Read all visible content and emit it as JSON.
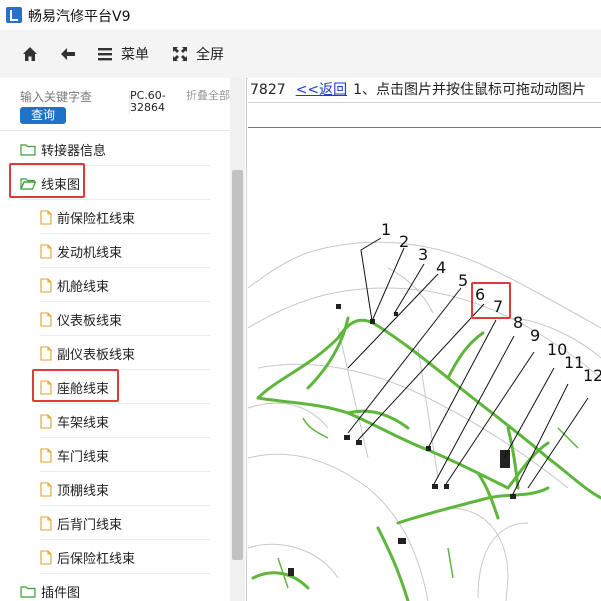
{
  "window": {
    "title": "畅易汽修平台V9"
  },
  "toolbar": {
    "home_icon": "home-icon",
    "back_icon": "back-arrow-icon",
    "menu_label": "菜单",
    "fullscreen_label": "全屏"
  },
  "search": {
    "placeholder": "输入关键字查",
    "button_label": "查询",
    "pc_code": "PC.60-32864",
    "collapse_label": "折叠全部"
  },
  "tree": {
    "items": [
      {
        "label": "转接器信息",
        "type": "folder",
        "expanded": false
      },
      {
        "label": "线束图",
        "type": "folder",
        "expanded": true,
        "highlighted": true
      },
      {
        "label": "前保险杠线束",
        "type": "doc"
      },
      {
        "label": "发动机线束",
        "type": "doc"
      },
      {
        "label": "机舱线束",
        "type": "doc"
      },
      {
        "label": "仪表板线束",
        "type": "doc"
      },
      {
        "label": "副仪表板线束",
        "type": "doc"
      },
      {
        "label": "座舱线束",
        "type": "doc",
        "highlighted": true
      },
      {
        "label": "车架线束",
        "type": "doc"
      },
      {
        "label": "车门线束",
        "type": "doc"
      },
      {
        "label": "顶棚线束",
        "type": "doc"
      },
      {
        "label": "后背门线束",
        "type": "doc"
      },
      {
        "label": "后保险杠线束",
        "type": "doc"
      },
      {
        "label": "插件图",
        "type": "folder",
        "expanded": false
      }
    ]
  },
  "content": {
    "code": "7827",
    "back_link": "<<返回",
    "hint": "1、点击图片并按住鼠标可拖动动图片",
    "callouts": [
      "1",
      "2",
      "3",
      "4",
      "5",
      "6",
      "7",
      "8",
      "9",
      "10",
      "11",
      "12"
    ],
    "highlighted_callouts": [
      "6",
      "7"
    ]
  },
  "colors": {
    "accent": "#1c73c8",
    "highlight": "#e03a3a",
    "folder": "#3a9d3a",
    "doc": "#e0a030",
    "harness": "#5fb63c",
    "link": "#1a3cc8"
  }
}
